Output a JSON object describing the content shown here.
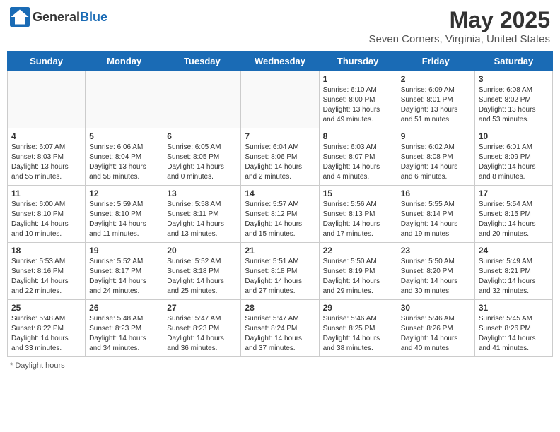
{
  "header": {
    "logo_general": "General",
    "logo_blue": "Blue",
    "month": "May 2025",
    "location": "Seven Corners, Virginia, United States"
  },
  "days_of_week": [
    "Sunday",
    "Monday",
    "Tuesday",
    "Wednesday",
    "Thursday",
    "Friday",
    "Saturday"
  ],
  "footer": {
    "note": "Daylight hours"
  },
  "weeks": [
    [
      {
        "day": "",
        "sunrise": "",
        "sunset": "",
        "daylight": ""
      },
      {
        "day": "",
        "sunrise": "",
        "sunset": "",
        "daylight": ""
      },
      {
        "day": "",
        "sunrise": "",
        "sunset": "",
        "daylight": ""
      },
      {
        "day": "",
        "sunrise": "",
        "sunset": "",
        "daylight": ""
      },
      {
        "day": "1",
        "sunrise": "Sunrise: 6:10 AM",
        "sunset": "Sunset: 8:00 PM",
        "daylight": "Daylight: 13 hours and 49 minutes."
      },
      {
        "day": "2",
        "sunrise": "Sunrise: 6:09 AM",
        "sunset": "Sunset: 8:01 PM",
        "daylight": "Daylight: 13 hours and 51 minutes."
      },
      {
        "day": "3",
        "sunrise": "Sunrise: 6:08 AM",
        "sunset": "Sunset: 8:02 PM",
        "daylight": "Daylight: 13 hours and 53 minutes."
      }
    ],
    [
      {
        "day": "4",
        "sunrise": "Sunrise: 6:07 AM",
        "sunset": "Sunset: 8:03 PM",
        "daylight": "Daylight: 13 hours and 55 minutes."
      },
      {
        "day": "5",
        "sunrise": "Sunrise: 6:06 AM",
        "sunset": "Sunset: 8:04 PM",
        "daylight": "Daylight: 13 hours and 58 minutes."
      },
      {
        "day": "6",
        "sunrise": "Sunrise: 6:05 AM",
        "sunset": "Sunset: 8:05 PM",
        "daylight": "Daylight: 14 hours and 0 minutes."
      },
      {
        "day": "7",
        "sunrise": "Sunrise: 6:04 AM",
        "sunset": "Sunset: 8:06 PM",
        "daylight": "Daylight: 14 hours and 2 minutes."
      },
      {
        "day": "8",
        "sunrise": "Sunrise: 6:03 AM",
        "sunset": "Sunset: 8:07 PM",
        "daylight": "Daylight: 14 hours and 4 minutes."
      },
      {
        "day": "9",
        "sunrise": "Sunrise: 6:02 AM",
        "sunset": "Sunset: 8:08 PM",
        "daylight": "Daylight: 14 hours and 6 minutes."
      },
      {
        "day": "10",
        "sunrise": "Sunrise: 6:01 AM",
        "sunset": "Sunset: 8:09 PM",
        "daylight": "Daylight: 14 hours and 8 minutes."
      }
    ],
    [
      {
        "day": "11",
        "sunrise": "Sunrise: 6:00 AM",
        "sunset": "Sunset: 8:10 PM",
        "daylight": "Daylight: 14 hours and 10 minutes."
      },
      {
        "day": "12",
        "sunrise": "Sunrise: 5:59 AM",
        "sunset": "Sunset: 8:10 PM",
        "daylight": "Daylight: 14 hours and 11 minutes."
      },
      {
        "day": "13",
        "sunrise": "Sunrise: 5:58 AM",
        "sunset": "Sunset: 8:11 PM",
        "daylight": "Daylight: 14 hours and 13 minutes."
      },
      {
        "day": "14",
        "sunrise": "Sunrise: 5:57 AM",
        "sunset": "Sunset: 8:12 PM",
        "daylight": "Daylight: 14 hours and 15 minutes."
      },
      {
        "day": "15",
        "sunrise": "Sunrise: 5:56 AM",
        "sunset": "Sunset: 8:13 PM",
        "daylight": "Daylight: 14 hours and 17 minutes."
      },
      {
        "day": "16",
        "sunrise": "Sunrise: 5:55 AM",
        "sunset": "Sunset: 8:14 PM",
        "daylight": "Daylight: 14 hours and 19 minutes."
      },
      {
        "day": "17",
        "sunrise": "Sunrise: 5:54 AM",
        "sunset": "Sunset: 8:15 PM",
        "daylight": "Daylight: 14 hours and 20 minutes."
      }
    ],
    [
      {
        "day": "18",
        "sunrise": "Sunrise: 5:53 AM",
        "sunset": "Sunset: 8:16 PM",
        "daylight": "Daylight: 14 hours and 22 minutes."
      },
      {
        "day": "19",
        "sunrise": "Sunrise: 5:52 AM",
        "sunset": "Sunset: 8:17 PM",
        "daylight": "Daylight: 14 hours and 24 minutes."
      },
      {
        "day": "20",
        "sunrise": "Sunrise: 5:52 AM",
        "sunset": "Sunset: 8:18 PM",
        "daylight": "Daylight: 14 hours and 25 minutes."
      },
      {
        "day": "21",
        "sunrise": "Sunrise: 5:51 AM",
        "sunset": "Sunset: 8:18 PM",
        "daylight": "Daylight: 14 hours and 27 minutes."
      },
      {
        "day": "22",
        "sunrise": "Sunrise: 5:50 AM",
        "sunset": "Sunset: 8:19 PM",
        "daylight": "Daylight: 14 hours and 29 minutes."
      },
      {
        "day": "23",
        "sunrise": "Sunrise: 5:50 AM",
        "sunset": "Sunset: 8:20 PM",
        "daylight": "Daylight: 14 hours and 30 minutes."
      },
      {
        "day": "24",
        "sunrise": "Sunrise: 5:49 AM",
        "sunset": "Sunset: 8:21 PM",
        "daylight": "Daylight: 14 hours and 32 minutes."
      }
    ],
    [
      {
        "day": "25",
        "sunrise": "Sunrise: 5:48 AM",
        "sunset": "Sunset: 8:22 PM",
        "daylight": "Daylight: 14 hours and 33 minutes."
      },
      {
        "day": "26",
        "sunrise": "Sunrise: 5:48 AM",
        "sunset": "Sunset: 8:23 PM",
        "daylight": "Daylight: 14 hours and 34 minutes."
      },
      {
        "day": "27",
        "sunrise": "Sunrise: 5:47 AM",
        "sunset": "Sunset: 8:23 PM",
        "daylight": "Daylight: 14 hours and 36 minutes."
      },
      {
        "day": "28",
        "sunrise": "Sunrise: 5:47 AM",
        "sunset": "Sunset: 8:24 PM",
        "daylight": "Daylight: 14 hours and 37 minutes."
      },
      {
        "day": "29",
        "sunrise": "Sunrise: 5:46 AM",
        "sunset": "Sunset: 8:25 PM",
        "daylight": "Daylight: 14 hours and 38 minutes."
      },
      {
        "day": "30",
        "sunrise": "Sunrise: 5:46 AM",
        "sunset": "Sunset: 8:26 PM",
        "daylight": "Daylight: 14 hours and 40 minutes."
      },
      {
        "day": "31",
        "sunrise": "Sunrise: 5:45 AM",
        "sunset": "Sunset: 8:26 PM",
        "daylight": "Daylight: 14 hours and 41 minutes."
      }
    ]
  ]
}
